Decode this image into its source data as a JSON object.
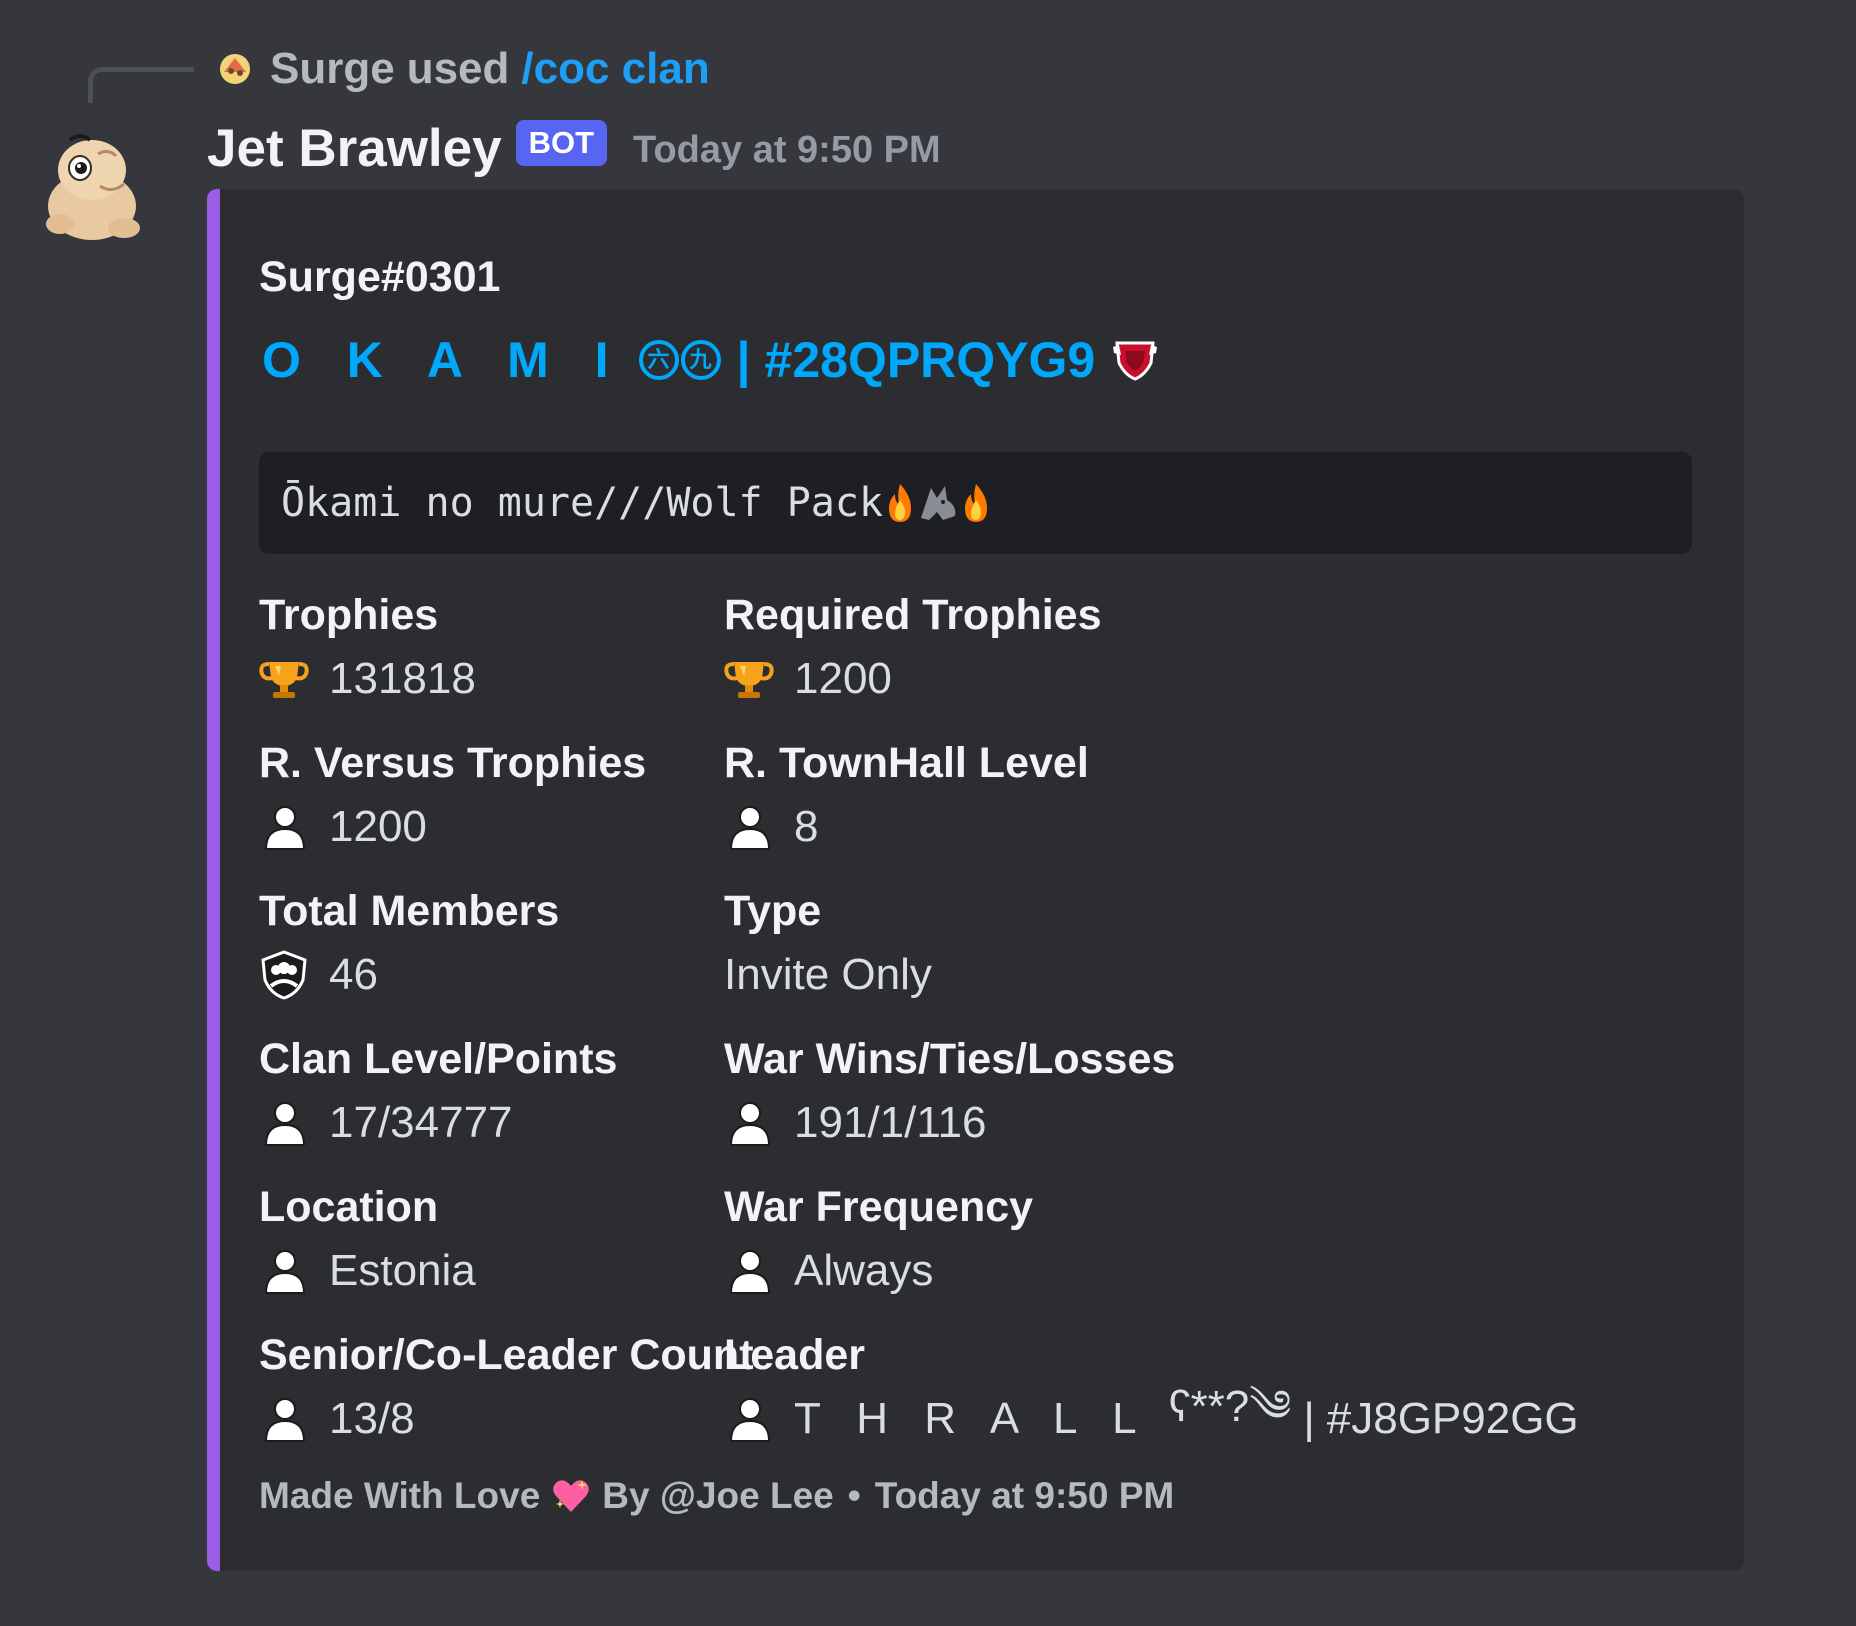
{
  "reply": {
    "user": "Surge",
    "verb": "used",
    "command": "/coc clan"
  },
  "message": {
    "author": "Jet Brawley",
    "bot_tag": "BOT",
    "timestamp": "Today at 9:50 PM"
  },
  "embed": {
    "accent_color": "#9b5de5",
    "author": "Surge#0301",
    "title_name": "O K A M I",
    "title_circled": [
      "六",
      "九"
    ],
    "title_separator": "|",
    "title_tag": "#28QPRQYG9",
    "description": "Ōkami no mure///Wolf Pack",
    "fields": [
      {
        "name": "Trophies",
        "value": "131818",
        "icon": "trophy-icon"
      },
      {
        "name": "Required Trophies",
        "value": "1200",
        "icon": "trophy-icon"
      },
      {
        "name": "R. Versus Trophies",
        "value": "1200",
        "icon": "person-icon"
      },
      {
        "name": "R. TownHall Level",
        "value": "8",
        "icon": "person-icon"
      },
      {
        "name": "Total Members",
        "value": "46",
        "icon": "members-badge-icon"
      },
      {
        "name": "Type",
        "value": "Invite Only",
        "icon": ""
      },
      {
        "name": "Clan Level/Points",
        "value": "17/34777",
        "icon": "person-icon"
      },
      {
        "name": "War Wins/Ties/Losses",
        "value": "191/1/116",
        "icon": "person-icon"
      },
      {
        "name": "Location",
        "value": "Estonia",
        "icon": "person-icon"
      },
      {
        "name": "War Frequency",
        "value": "Always",
        "icon": "person-icon"
      },
      {
        "name": "Senior/Co-Leader Count",
        "value": "13/8",
        "icon": "person-icon"
      },
      {
        "name": "Leader",
        "value_name": "T H R A L L",
        "value_glyph": "ʕ**?༄",
        "value_separator": "|",
        "value_tag": "#J8GP92GG",
        "icon": "person-icon"
      }
    ],
    "footer": {
      "made_with": "Made With Love",
      "by": "By @Joe Lee",
      "separator": "•",
      "timestamp": "Today at 9:50 PM"
    }
  }
}
